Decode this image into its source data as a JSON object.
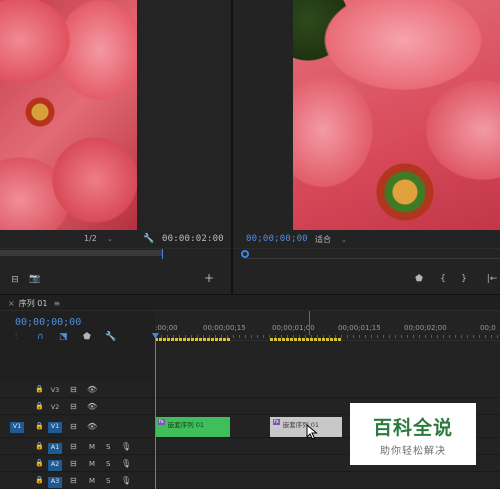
{
  "source_monitor": {
    "zoom": "1/2",
    "timecode": "00:00:02:00",
    "add_icon": "plus-icon"
  },
  "program_monitor": {
    "timecode": "00;00;00;00",
    "fit": "适合"
  },
  "timeline": {
    "tab_title": "序列 01",
    "timecode": "00;00;00;00",
    "ruler_labels": [
      ":00;00",
      "00;00;00;15",
      "00;00;01;00",
      "00;00;01;15",
      "00;00;02;00",
      "00;0"
    ],
    "tracks": [
      {
        "name": "V3",
        "kind": "video"
      },
      {
        "name": "V2",
        "kind": "video"
      },
      {
        "name": "V1",
        "kind": "video",
        "source": "V1"
      },
      {
        "name": "A1",
        "kind": "audio"
      },
      {
        "name": "A2",
        "kind": "audio"
      },
      {
        "name": "A3",
        "kind": "audio"
      }
    ],
    "audio_m": "M",
    "audio_s": "S",
    "clips": [
      {
        "label": "嵌套序列 01",
        "fx": "fx",
        "color": "#3fbf5c"
      },
      {
        "label": "嵌套序列 01",
        "fx": "fx",
        "color": "#c8c8c8"
      }
    ],
    "work_area_color": "#d8c23a",
    "playhead_color": "#3e86e6"
  },
  "watermark": {
    "title": "百科全说",
    "subtitle": "助你轻松解决"
  }
}
